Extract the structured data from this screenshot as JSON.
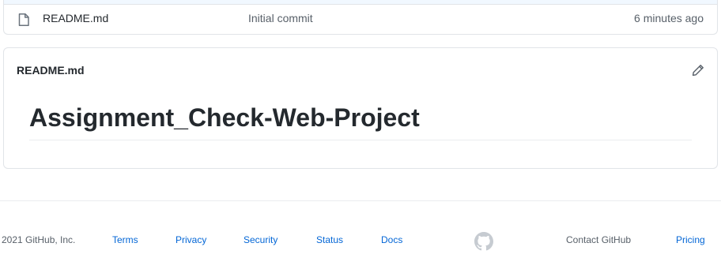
{
  "file_list": {
    "rows": [
      {
        "icon": "file-icon",
        "name": "README.md",
        "commit_message": "Initial commit",
        "age": "6 minutes ago"
      }
    ]
  },
  "readme": {
    "header": "README.md",
    "edit_icon": "pencil-icon",
    "heading": "Assignment_Check-Web-Project"
  },
  "footer": {
    "copyright": "2021 GitHub, Inc.",
    "links": {
      "terms": "Terms",
      "privacy": "Privacy",
      "security": "Security",
      "status": "Status",
      "docs": "Docs",
      "contact": "Contact GitHub",
      "pricing": "Pricing"
    },
    "logo_icon": "github-octocat-icon"
  },
  "colors": {
    "link": "#0366d6",
    "muted": "#586069",
    "text": "#24292e",
    "border": "#e1e4e8"
  }
}
